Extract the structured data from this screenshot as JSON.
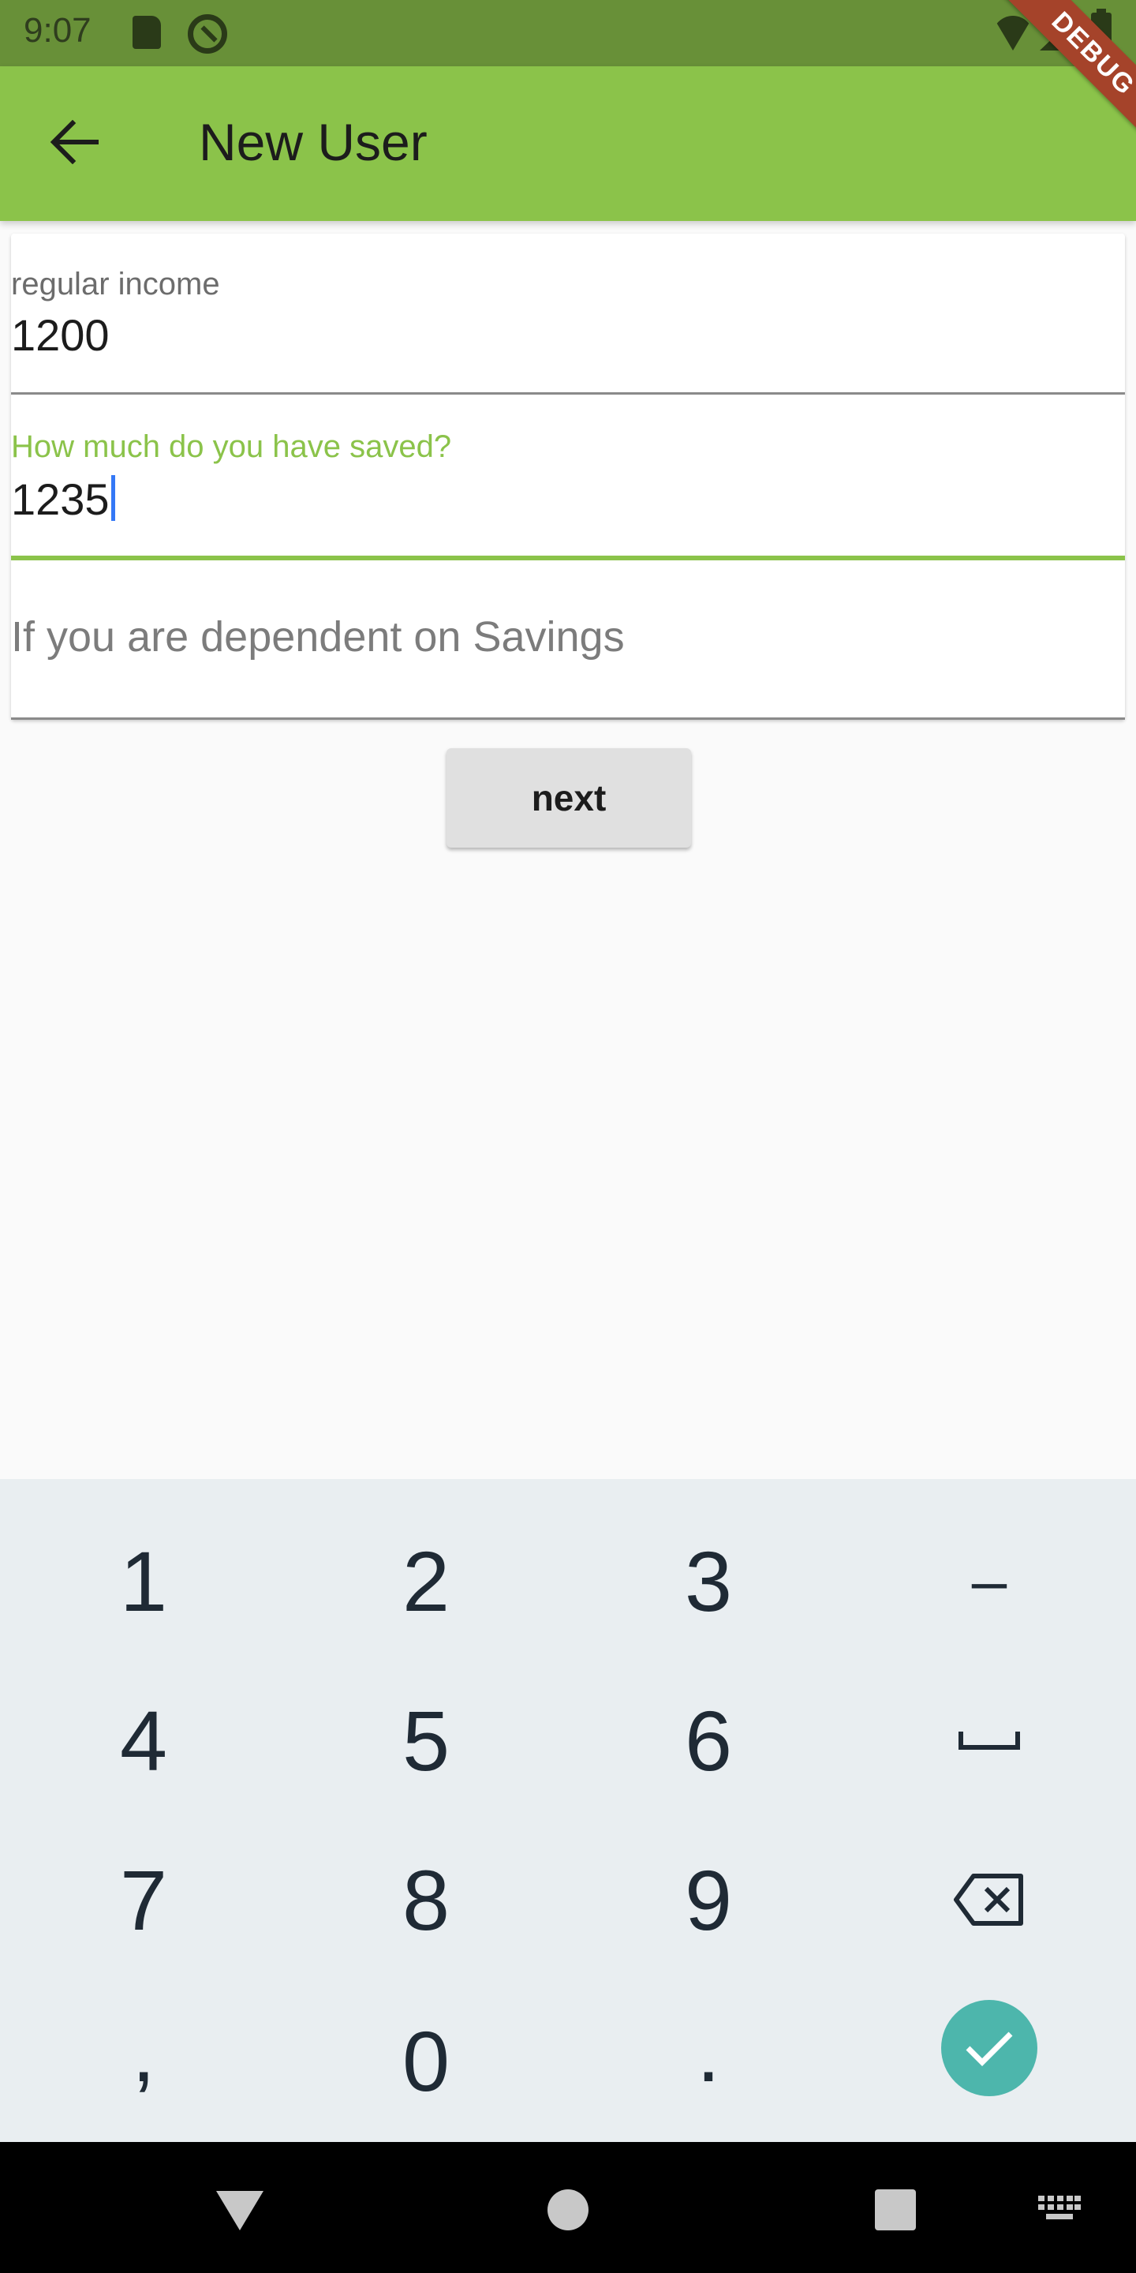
{
  "status_bar": {
    "time": "9:07",
    "icons": [
      "sd-card-icon",
      "sync-icon",
      "wifi-icon",
      "signal-icon",
      "battery-icon"
    ]
  },
  "debug_banner": "DEBUG",
  "app_bar": {
    "title": "New User",
    "back_icon": "arrow-left-icon"
  },
  "form": {
    "regular_income": {
      "label": "regular income",
      "value": "1200"
    },
    "savings": {
      "label": "How much do you have saved?",
      "value": "1235"
    },
    "dependent": {
      "placeholder": "If you are dependent on Savings"
    }
  },
  "next_button": "next",
  "keyboard": {
    "row1": [
      "1",
      "2",
      "3",
      "–"
    ],
    "row2": [
      "4",
      "5",
      "6",
      "␣"
    ],
    "row3": [
      "7",
      "8",
      "9"
    ],
    "row4": [
      ",",
      "0",
      "."
    ],
    "special_icons": [
      "space-icon",
      "backspace-icon",
      "check-icon"
    ]
  },
  "nav_bar": {
    "icons": [
      "nav-back-icon",
      "nav-home-icon",
      "nav-recents-icon",
      "keyboard-switch-icon"
    ]
  },
  "colors": {
    "status_bar": "#689038",
    "app_bar": "#8bc34a",
    "accent": "#8bc34a",
    "caret": "#3478f6",
    "debug_banner": "#a5432a",
    "keyboard_bg": "#e9eef1",
    "confirm_key": "#4db6ac"
  }
}
